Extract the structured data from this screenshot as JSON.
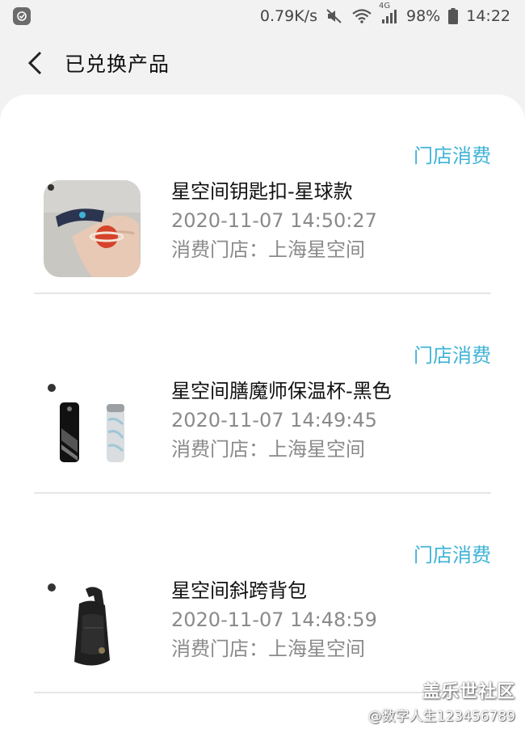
{
  "status_bar": {
    "speed": "0.79K/s",
    "battery": "98%",
    "time": "14:22",
    "network": "4G"
  },
  "header": {
    "title": "已兑换产品"
  },
  "orders": [
    {
      "type": "门店消费",
      "name": "星空间钥匙扣-星球款",
      "time": "2020-11-07 14:50:27",
      "store": "消费门店：上海星空间",
      "thumb_icon": "keychain-image"
    },
    {
      "type": "门店消费",
      "name": "星空间膳魔师保温杯-黑色",
      "time": "2020-11-07 14:49:45",
      "store": "消费门店：上海星空间",
      "thumb_icon": "thermos-image"
    },
    {
      "type": "门店消费",
      "name": "星空间斜跨背包",
      "time": "2020-11-07 14:48:59",
      "store": "消费门店：上海星空间",
      "thumb_icon": "backpack-image"
    }
  ],
  "watermark": {
    "title": "盖乐世社区",
    "subtitle": "@数字人生123456789"
  },
  "colors": {
    "accent": "#3fb3d6",
    "secondary_text": "#8a8a8a",
    "background": "#f2f2f2"
  }
}
